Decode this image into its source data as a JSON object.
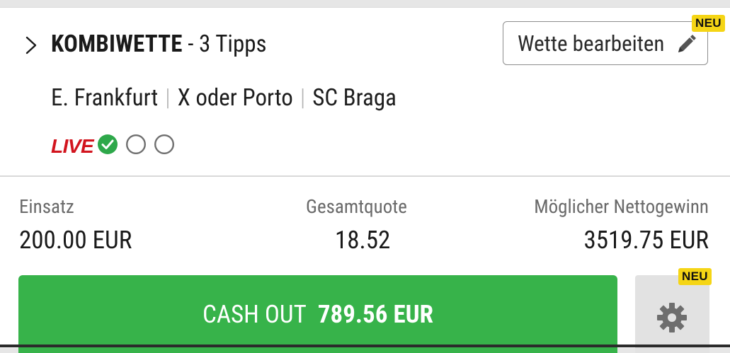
{
  "bet": {
    "type_label": "KOMBIWETTE",
    "tips_label": " - 3 Tipps",
    "edit_button": "Wette bearbeiten",
    "edit_badge": "NEU",
    "selections": [
      "E. Frankfurt",
      "X oder Porto",
      "SC Braga"
    ],
    "separator": "|",
    "live_label": "LIVE",
    "selection_status": [
      "won",
      "open",
      "open"
    ]
  },
  "stats": {
    "stake_label": "Einsatz",
    "stake_value": "200.00 EUR",
    "odds_label": "Gesamtquote",
    "odds_value": "18.52",
    "win_label": "Möglicher Nettogewinn",
    "win_value": "3519.75 EUR"
  },
  "cashout": {
    "label": "CASH OUT",
    "amount": "789.56 EUR",
    "settings_badge": "NEU"
  },
  "colors": {
    "cashout_green": "#37b34a",
    "live_red": "#d2141e",
    "badge_yellow": "#f5d515",
    "won_green": "#2ea84a"
  },
  "icons": {
    "expand": "chevron-right-icon",
    "edit": "pencil-icon",
    "won": "check-circle-icon",
    "open": "empty-circle-icon",
    "settings": "gear-icon"
  }
}
